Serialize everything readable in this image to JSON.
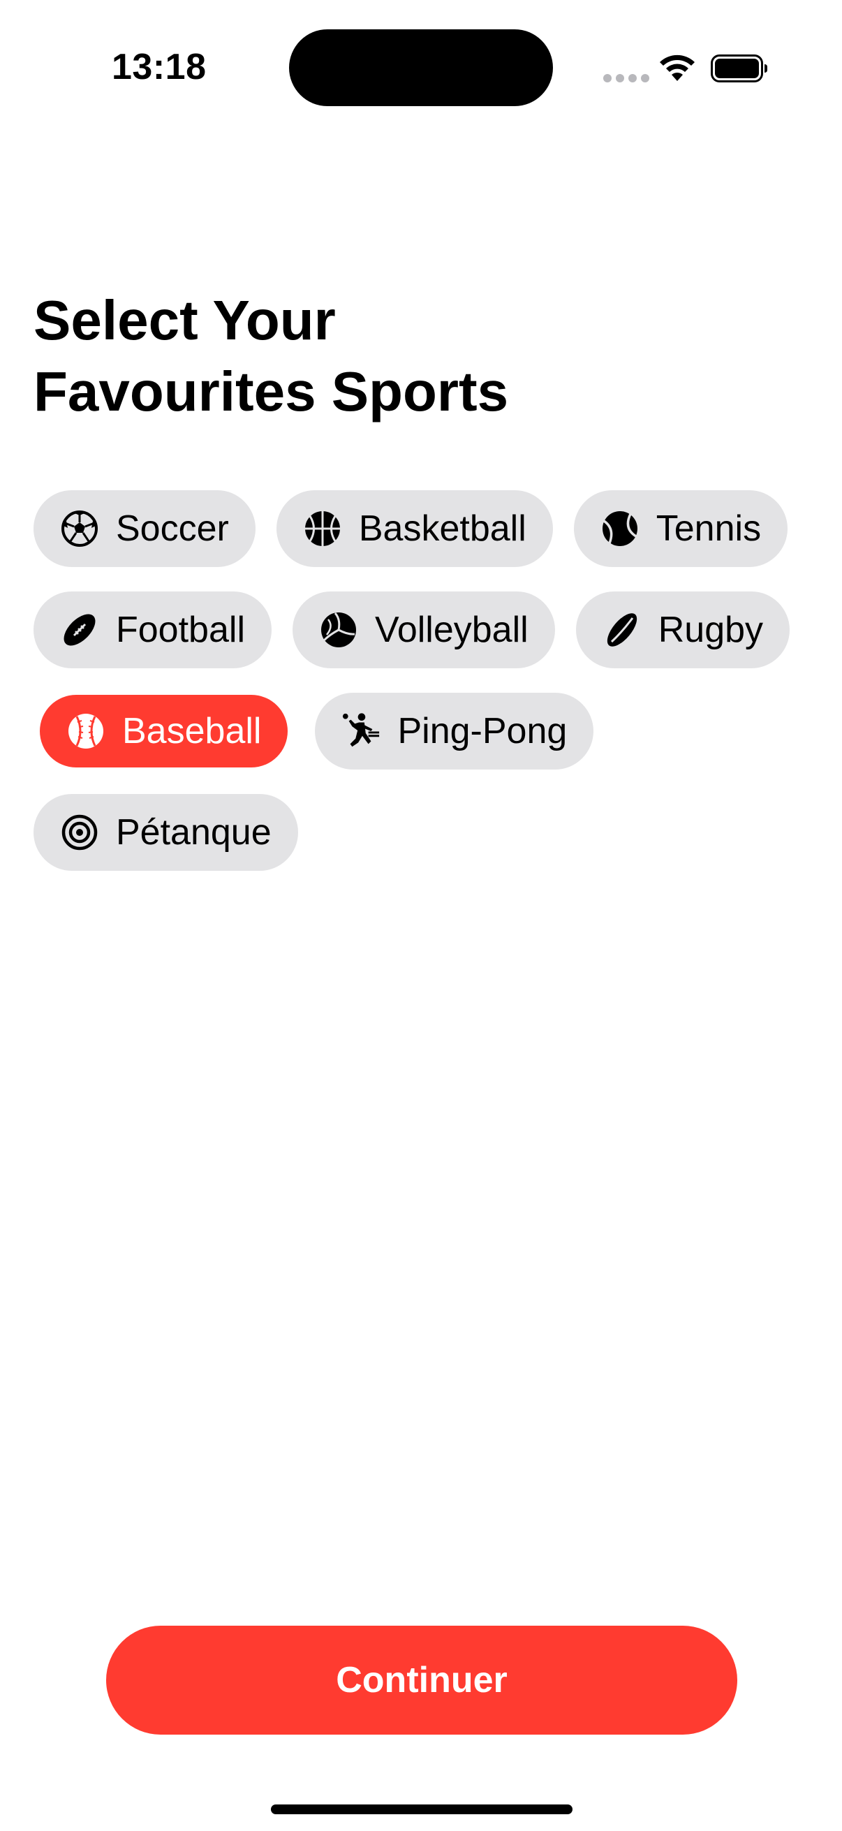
{
  "status_bar": {
    "time": "13:18",
    "icons": [
      "signal-dots-icon",
      "wifi-icon",
      "battery-icon"
    ]
  },
  "title": {
    "line1": "Select Your",
    "line2": "Favourites Sports"
  },
  "sports": [
    {
      "label": "Soccer",
      "icon": "soccer-ball-icon",
      "selected": false
    },
    {
      "label": "Basketball",
      "icon": "basketball-icon",
      "selected": false
    },
    {
      "label": "Tennis",
      "icon": "tennis-ball-icon",
      "selected": false
    },
    {
      "label": "Football",
      "icon": "american-football-icon",
      "selected": false
    },
    {
      "label": "Volleyball",
      "icon": "volleyball-icon",
      "selected": false
    },
    {
      "label": "Rugby",
      "icon": "rugby-ball-icon",
      "selected": false
    },
    {
      "label": "Baseball",
      "icon": "baseball-icon",
      "selected": true
    },
    {
      "label": "Ping-Pong",
      "icon": "ping-pong-player-icon",
      "selected": false
    },
    {
      "label": "Pétanque",
      "icon": "target-icon",
      "selected": false
    }
  ],
  "continue_button": {
    "label": "Continuer"
  },
  "colors": {
    "accent": "#ff3b30",
    "chip_background": "#e3e3e5",
    "text": "#000000",
    "selected_text": "#ffffff"
  }
}
